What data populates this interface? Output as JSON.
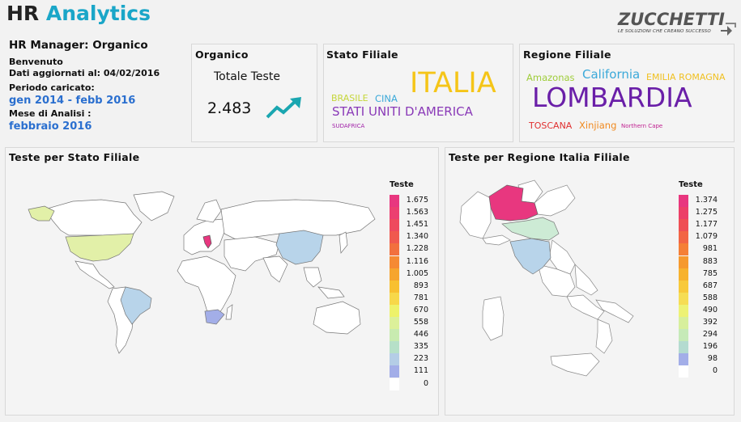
{
  "header": {
    "title_part1": "HR",
    "title_part2": "Analytics"
  },
  "logo": {
    "name": "ZUCCHETTI",
    "tagline": "LE SOLUZIONI CHE CREANO SUCCESSO"
  },
  "info": {
    "manager": "HR Manager: Organico",
    "welcome": "Benvenuto",
    "updated": "Dati aggiornati al: 04/02/2016",
    "period_label": "Periodo caricato:",
    "period_value": "gen 2014 - febb 2016",
    "month_label": "Mese di Analisi :",
    "month_value": "febbraio 2016"
  },
  "organico": {
    "title": "Organico",
    "label": "Totale Teste",
    "value": "2.483"
  },
  "stato_filiale": {
    "title": "Stato  Filiale",
    "words": [
      "BRASILE",
      "CINA",
      "ITALIA",
      "STATI UNITI D'AMERICA",
      "SUDAFRICA"
    ]
  },
  "regione_filiale": {
    "title": "Regione  Filiale",
    "words": [
      "Amazonas",
      "California",
      "EMILIA ROMAGNA",
      "LOMBARDIA",
      "TOSCANA",
      "Xinjiang",
      "Northern Cape"
    ]
  },
  "colors": {
    "accent": "#1aa6c8",
    "italia": "#f5c518",
    "lombardia": "#6a1fa8",
    "california": "#3ba9d9"
  },
  "map_world": {
    "title": "Teste  per  Stato  Filiale",
    "legend_title": "Teste",
    "legend": [
      "1.675",
      "1.563",
      "1.451",
      "1.340",
      "1.228",
      "1.116",
      "1.005",
      "893",
      "781",
      "670",
      "558",
      "446",
      "335",
      "223",
      "111",
      "0"
    ]
  },
  "map_italy": {
    "title": "Teste  per  Regione  Italia  Filiale",
    "legend_title": "Teste",
    "legend": [
      "1.374",
      "1.275",
      "1.177",
      "1.079",
      "981",
      "883",
      "785",
      "687",
      "588",
      "490",
      "392",
      "294",
      "196",
      "98",
      "0"
    ]
  }
}
